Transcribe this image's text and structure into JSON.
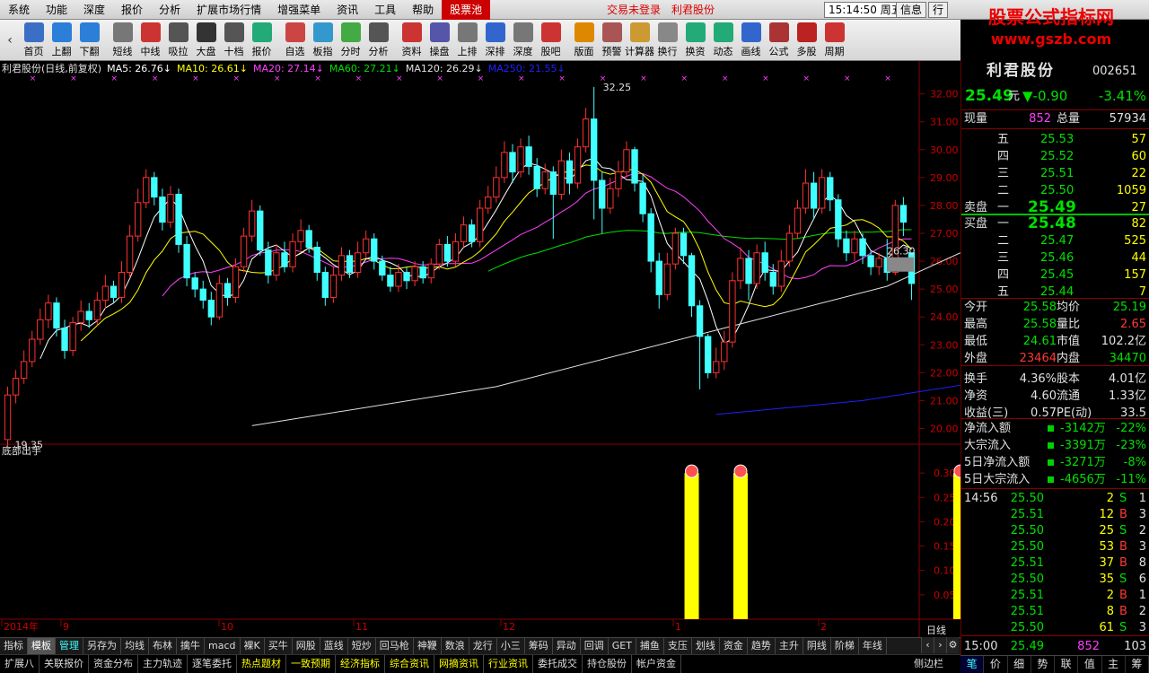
{
  "menu": {
    "items": [
      "系统",
      "功能",
      "深度",
      "报价",
      "分析",
      "扩展市场行情",
      "增强菜单",
      "资讯",
      "工具",
      "帮助"
    ],
    "active": "股票池",
    "status1": "交易未登录",
    "status2": "利君股份",
    "clock": "15:14:50 周五",
    "info": "信息",
    "trade": "行"
  },
  "toolbar": {
    "back": "‹",
    "items": [
      "首页",
      "上翻",
      "下翻",
      "短线",
      "中线",
      "吸拉",
      "大盘",
      "十档",
      "报价",
      "自选",
      "板指",
      "分时",
      "分析",
      "资料",
      "操盘",
      "上排",
      "深排",
      "深度",
      "股吧",
      "版面",
      "预警",
      "计算器",
      "换行",
      "换资",
      "动态",
      "画线",
      "公式",
      "多股",
      "周期"
    ]
  },
  "logo": {
    "title": "股票公式指标网",
    "url": "www.gszb.com"
  },
  "chart_data": [
    {
      "type": "candlestick",
      "title": "利君股份(日线,前复权)",
      "ma": [
        {
          "name": "MA5",
          "value": "26.76",
          "color": "#ffffff"
        },
        {
          "name": "MA10",
          "value": "26.61",
          "color": "#ffff00"
        },
        {
          "name": "MA20",
          "value": "27.14",
          "color": "#ff40ff"
        },
        {
          "name": "MA60",
          "value": "27.21",
          "color": "#00e000"
        },
        {
          "name": "MA120",
          "value": "26.29",
          "color": "#e0e0e0"
        },
        {
          "name": "MA250",
          "value": "21.55",
          "color": "#2020ff"
        }
      ],
      "ylim": [
        19.5,
        32.6
      ],
      "yticks": [
        "32.00",
        "31.00",
        "30.00",
        "29.00",
        "28.00",
        "27.00",
        "26.00",
        "25.00",
        "24.00",
        "23.00",
        "22.00",
        "21.00",
        "20.00"
      ],
      "high_label": "32.25",
      "low_label": "19.35",
      "last_label": "26.30",
      "x_labels": [
        "2014年",
        "9",
        "10",
        "11",
        "12",
        "1",
        "2"
      ],
      "x_unit": "日线",
      "candles": [
        [
          19.6,
          21.2,
          19.35,
          21.5
        ],
        [
          21.2,
          21.8,
          20.9,
          22.1
        ],
        [
          21.8,
          22.4,
          21.6,
          22.8
        ],
        [
          22.4,
          23.2,
          22.2,
          23.5
        ],
        [
          23.2,
          23.9,
          23.0,
          24.3
        ],
        [
          23.9,
          24.5,
          23.6,
          24.8
        ],
        [
          24.5,
          23.6,
          23.3,
          24.7
        ],
        [
          23.6,
          22.8,
          22.5,
          23.9
        ],
        [
          22.8,
          23.8,
          22.6,
          24.0
        ],
        [
          23.8,
          24.2,
          23.5,
          24.6
        ],
        [
          24.2,
          23.9,
          23.6,
          24.5
        ],
        [
          23.9,
          24.6,
          23.7,
          24.9
        ],
        [
          24.6,
          25.1,
          24.3,
          25.5
        ],
        [
          25.1,
          24.7,
          24.5,
          25.3
        ],
        [
          24.7,
          25.6,
          24.5,
          26.0
        ],
        [
          25.6,
          26.9,
          25.4,
          27.3
        ],
        [
          26.9,
          28.1,
          26.7,
          28.6
        ],
        [
          28.1,
          29.0,
          27.9,
          29.3
        ],
        [
          29.0,
          28.3,
          28.0,
          29.2
        ],
        [
          28.3,
          27.4,
          27.1,
          28.6
        ],
        [
          27.4,
          28.4,
          27.2,
          28.7
        ],
        [
          28.4,
          26.6,
          26.3,
          28.6
        ],
        [
          26.6,
          25.4,
          25.1,
          26.9
        ],
        [
          25.4,
          25.0,
          24.7,
          25.6
        ],
        [
          25.0,
          24.6,
          24.3,
          25.3
        ],
        [
          24.6,
          24.0,
          23.7,
          24.9
        ],
        [
          24.0,
          25.2,
          23.9,
          25.5
        ],
        [
          25.2,
          24.7,
          24.4,
          25.4
        ],
        [
          24.7,
          25.8,
          24.5,
          26.1
        ],
        [
          25.8,
          26.9,
          25.6,
          27.2
        ],
        [
          26.9,
          27.8,
          26.7,
          28.2
        ],
        [
          27.8,
          26.4,
          26.2,
          28.0
        ],
        [
          26.4,
          25.5,
          25.2,
          26.7
        ],
        [
          25.5,
          26.3,
          25.3,
          26.6
        ],
        [
          26.3,
          25.8,
          25.6,
          26.7
        ],
        [
          25.8,
          26.7,
          25.6,
          27.0
        ],
        [
          26.7,
          27.1,
          26.4,
          27.5
        ],
        [
          27.1,
          26.5,
          26.3,
          27.3
        ],
        [
          26.5,
          25.6,
          25.3,
          26.7
        ],
        [
          25.6,
          24.7,
          24.4,
          25.8
        ],
        [
          24.7,
          25.5,
          24.5,
          25.8
        ],
        [
          25.5,
          26.2,
          25.3,
          26.5
        ],
        [
          26.2,
          25.6,
          25.4,
          26.4
        ],
        [
          25.6,
          26.3,
          25.4,
          26.7
        ],
        [
          26.3,
          26.8,
          26.1,
          27.1
        ],
        [
          26.8,
          26.0,
          25.7,
          27.0
        ],
        [
          26.0,
          25.5,
          25.3,
          26.2
        ],
        [
          25.5,
          25.1,
          24.9,
          25.8
        ],
        [
          25.1,
          25.6,
          24.9,
          25.9
        ],
        [
          25.6,
          25.3,
          25.0,
          25.8
        ],
        [
          25.3,
          25.8,
          25.1,
          26.0
        ],
        [
          25.8,
          25.4,
          25.2,
          26.0
        ],
        [
          25.4,
          25.9,
          25.2,
          26.1
        ],
        [
          25.9,
          26.6,
          25.7,
          26.8
        ],
        [
          26.6,
          26.0,
          25.8,
          26.9
        ],
        [
          26.0,
          26.7,
          25.8,
          27.0
        ],
        [
          26.7,
          27.3,
          26.5,
          27.6
        ],
        [
          27.3,
          26.7,
          26.5,
          27.5
        ],
        [
          26.7,
          27.9,
          26.5,
          28.2
        ],
        [
          27.9,
          28.3,
          27.7,
          28.7
        ],
        [
          28.3,
          29.0,
          28.1,
          29.4
        ],
        [
          29.0,
          29.9,
          28.8,
          30.3
        ],
        [
          29.9,
          29.2,
          28.8,
          30.2
        ],
        [
          29.2,
          30.1,
          29.0,
          30.4
        ],
        [
          30.1,
          29.4,
          29.1,
          30.5
        ],
        [
          29.4,
          28.6,
          28.3,
          29.7
        ],
        [
          28.6,
          29.2,
          28.4,
          29.5
        ],
        [
          29.2,
          28.4,
          26.8,
          29.4
        ],
        [
          28.4,
          29.6,
          28.2,
          30.0
        ],
        [
          29.6,
          28.8,
          28.4,
          29.9
        ],
        [
          28.8,
          30.1,
          28.6,
          30.4
        ],
        [
          30.1,
          31.1,
          29.9,
          31.5
        ],
        [
          31.1,
          28.9,
          27.5,
          32.25
        ],
        [
          28.9,
          27.9,
          27.0,
          29.2
        ],
        [
          27.9,
          28.6,
          27.7,
          29.0
        ],
        [
          28.6,
          29.2,
          28.3,
          29.6
        ],
        [
          29.2,
          30.0,
          29.0,
          30.3
        ],
        [
          30.0,
          28.8,
          28.5,
          30.1
        ],
        [
          28.8,
          27.7,
          27.4,
          29.1
        ],
        [
          27.7,
          26.0,
          25.6,
          27.9
        ],
        [
          26.0,
          24.8,
          24.3,
          26.3
        ],
        [
          24.8,
          25.9,
          24.6,
          26.3
        ],
        [
          25.9,
          27.0,
          25.7,
          27.2
        ],
        [
          27.0,
          26.2,
          25.9,
          27.2
        ],
        [
          26.2,
          24.4,
          24.0,
          26.3
        ],
        [
          24.4,
          23.3,
          21.4,
          24.6
        ],
        [
          23.3,
          22.0,
          21.8,
          23.4
        ],
        [
          22.0,
          22.4,
          21.8,
          22.9
        ],
        [
          22.4,
          23.1,
          22.1,
          23.5
        ],
        [
          23.1,
          25.3,
          22.9,
          25.6
        ],
        [
          25.3,
          26.1,
          25.0,
          26.5
        ],
        [
          26.1,
          25.2,
          24.6,
          26.4
        ],
        [
          25.2,
          26.3,
          25.0,
          26.6
        ],
        [
          26.3,
          25.6,
          25.3,
          26.7
        ],
        [
          25.6,
          25.1,
          24.8,
          25.9
        ],
        [
          25.1,
          26.0,
          24.9,
          26.4
        ],
        [
          26.0,
          27.0,
          25.8,
          27.3
        ],
        [
          27.0,
          27.9,
          26.8,
          28.2
        ],
        [
          27.9,
          28.8,
          27.7,
          29.3
        ],
        [
          28.8,
          27.9,
          27.5,
          29.2
        ],
        [
          27.9,
          29.0,
          27.7,
          29.3
        ],
        [
          29.0,
          28.2,
          27.8,
          29.2
        ],
        [
          28.2,
          26.8,
          26.5,
          28.4
        ],
        [
          26.8,
          26.3,
          26.0,
          27.1
        ],
        [
          26.3,
          26.8,
          26.0,
          27.1
        ],
        [
          26.8,
          26.2,
          25.9,
          27.0
        ],
        [
          26.2,
          25.8,
          25.5,
          26.4
        ],
        [
          25.8,
          26.1,
          25.5,
          26.3
        ],
        [
          26.1,
          25.6,
          25.3,
          26.8
        ],
        [
          25.6,
          28.0,
          25.5,
          28.2
        ],
        [
          28.0,
          27.4,
          26.9,
          28.3
        ],
        [
          26.3,
          25.2,
          24.61,
          26.3
        ]
      ]
    },
    {
      "type": "bar",
      "title": "底部出手",
      "ylim": [
        0,
        0.35
      ],
      "yticks": [
        "0.30",
        "0.25",
        "0.20",
        "0.15",
        "0.10",
        "0.05"
      ],
      "marks": [
        {
          "i": 84,
          "value": 0.3
        },
        {
          "i": 90,
          "value": 0.3
        },
        {
          "i": 117,
          "value": 0.3
        },
        {
          "i": 121,
          "value": 0.3
        }
      ]
    }
  ],
  "tabs1": [
    "指标",
    "模板",
    "管理",
    "另存为",
    "均线",
    "布林",
    "擒牛",
    "macd",
    "裸K",
    "买牛",
    "网股",
    "蓝线",
    "短炒",
    "回马枪",
    "神鞭",
    "数浪",
    "龙行",
    "小三",
    "筹码",
    "异动",
    "回调",
    "GET",
    "捕鱼",
    "支压",
    "划线",
    "资金",
    "趋势",
    "主升",
    "阴线",
    "阶梯",
    "年线"
  ],
  "tabs2": [
    "扩展八",
    "关联报价",
    "资金分布",
    "主力轨迹",
    "逐笔委托",
    "热点题材",
    "一致预期",
    "经济指标",
    "综合资讯",
    "网摘资讯",
    "行业资讯",
    "委托成交",
    "持仓股份",
    "帐户资金"
  ],
  "sidebar_label": "侧边栏",
  "right": {
    "name": "利君股份",
    "code": "002651",
    "price": "25.49",
    "unit": "元",
    "change": "▼-0.90",
    "pct": "-3.41%",
    "vol_label": "现量",
    "vol": "852",
    "total_label": "总量",
    "total": "57934",
    "sell": [
      [
        "五",
        "25.53",
        "57"
      ],
      [
        "四",
        "25.52",
        "60"
      ],
      [
        "三",
        "25.51",
        "22"
      ],
      [
        "二",
        "25.50",
        "1059"
      ],
      [
        "一",
        "25.49",
        "27"
      ]
    ],
    "sell_label": "卖盘",
    "buy_label": "买盘",
    "buy": [
      [
        "一",
        "25.48",
        "82"
      ],
      [
        "二",
        "25.47",
        "525"
      ],
      [
        "三",
        "25.46",
        "44"
      ],
      [
        "四",
        "25.45",
        "157"
      ],
      [
        "五",
        "25.44",
        "7"
      ]
    ],
    "stats": [
      [
        "今开",
        "25.58",
        "均价",
        "25.19"
      ],
      [
        "最高",
        "25.58",
        "量比",
        "2.65"
      ],
      [
        "最低",
        "24.61",
        "市值",
        "102.2亿"
      ],
      [
        "外盘",
        "23464",
        "内盘",
        "34470"
      ],
      [
        "换手",
        "4.36%",
        "股本",
        "4.01亿"
      ],
      [
        "净资",
        "4.60",
        "流通",
        "1.33亿"
      ],
      [
        "收益(三)",
        "0.57",
        "PE(动)",
        "33.5"
      ]
    ],
    "flows": [
      [
        "净流入额",
        "-3142万",
        "-22%"
      ],
      [
        "大宗流入",
        "-3391万",
        "-23%"
      ],
      [
        "5日净流入额",
        "-3271万",
        "-8%"
      ],
      [
        "5日大宗流入",
        "-4656万",
        "-11%"
      ]
    ],
    "ticks": [
      [
        "14:56",
        "25.50",
        "2",
        "S"
      ],
      [
        "",
        "25.51",
        "12",
        "B"
      ],
      [
        "",
        "25.50",
        "25",
        "S"
      ],
      [
        "",
        "25.50",
        "53",
        "B"
      ],
      [
        "",
        "25.51",
        "37",
        "B"
      ],
      [
        "",
        "25.50",
        "35",
        "S"
      ],
      [
        "",
        "25.51",
        "2",
        "B"
      ],
      [
        "",
        "25.51",
        "8",
        "B"
      ],
      [
        "",
        "25.50",
        "61",
        "S"
      ]
    ],
    "tick_nums": [
      "1",
      "3",
      "2",
      "3",
      "8",
      "6",
      "1",
      "2",
      "3"
    ],
    "last_tick": [
      "15:00",
      "25.49",
      "852",
      "103"
    ],
    "tabs": [
      "笔",
      "价",
      "细",
      "势",
      "联",
      "值",
      "主",
      "筹"
    ]
  }
}
